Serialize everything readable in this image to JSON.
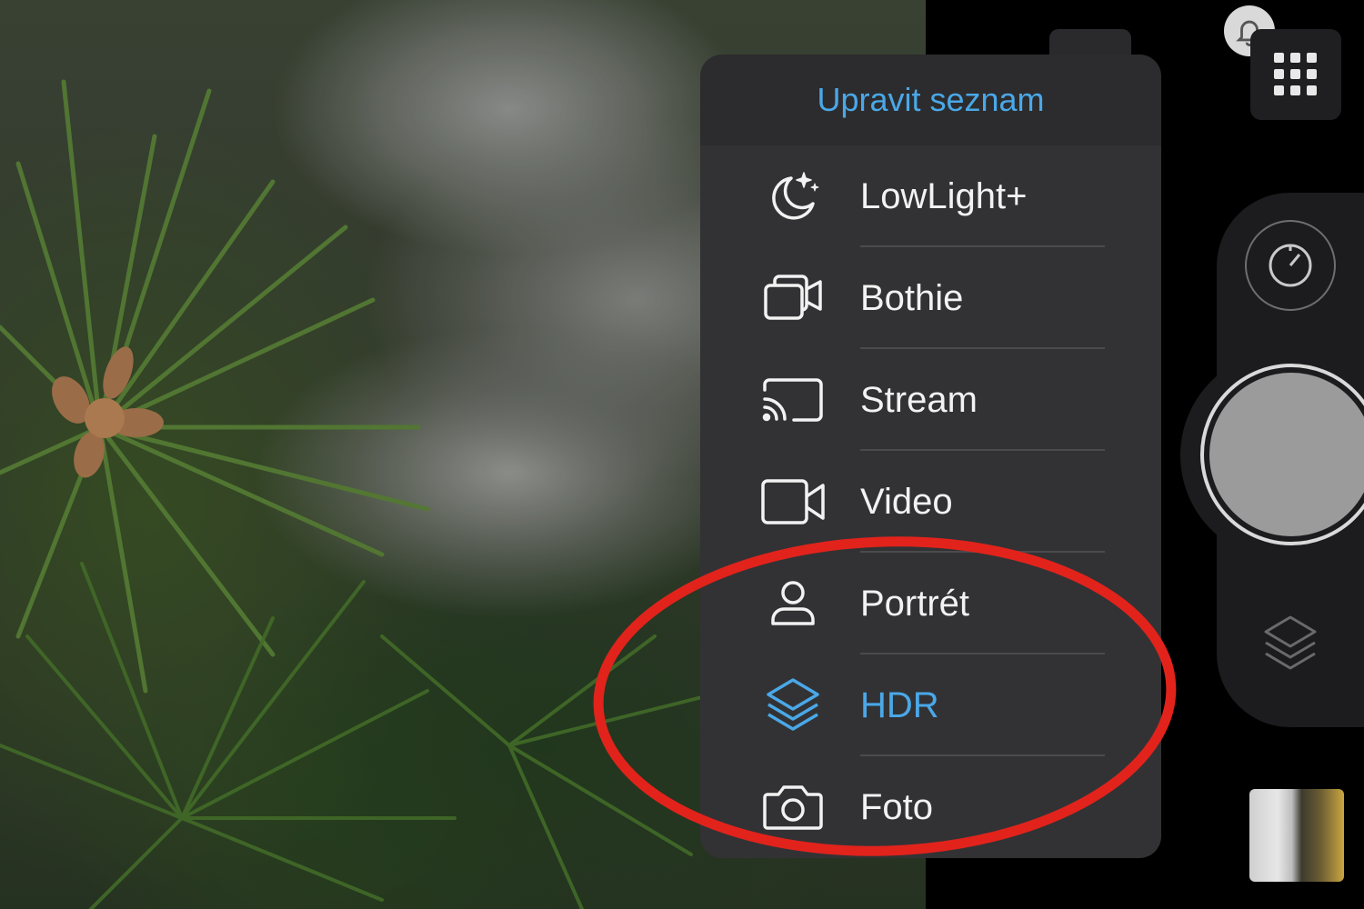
{
  "menu": {
    "header": "Upravit seznam",
    "items": [
      {
        "label": "LowLight+",
        "icon": "moon-stars-icon"
      },
      {
        "label": "Bothie",
        "icon": "dual-camera-icon"
      },
      {
        "label": "Stream",
        "icon": "cast-icon"
      },
      {
        "label": "Video",
        "icon": "video-camera-icon"
      },
      {
        "label": "Portrét",
        "icon": "person-icon"
      },
      {
        "label": "HDR",
        "icon": "layers-icon",
        "active": true
      },
      {
        "label": "Foto",
        "icon": "camera-icon"
      }
    ]
  },
  "colors": {
    "accent": "#4aa8e8",
    "menu_bg": "#323234",
    "annotation": "#e1231c"
  }
}
